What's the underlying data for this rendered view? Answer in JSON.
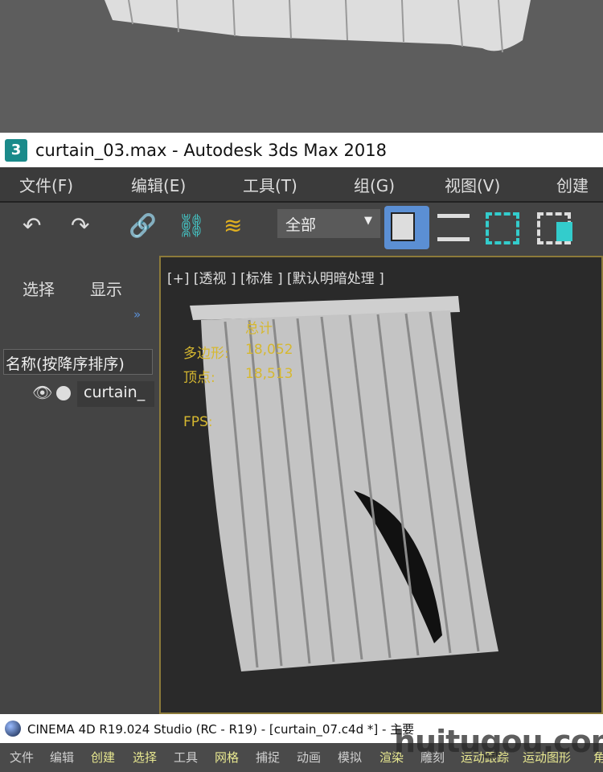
{
  "max_window": {
    "title": "curtain_03.max - Autodesk 3ds Max 2018",
    "logo": "3",
    "menu": [
      "文件(F)",
      "编辑(E)",
      "工具(T)",
      "组(G)",
      "视图(V)",
      "创建"
    ],
    "toolbar": {
      "selection_filter": "全部",
      "icons": [
        "undo-icon",
        "redo-icon",
        "link-icon",
        "unlink-icon",
        "bind-space-warp-icon",
        "select-object-icon",
        "select-by-name-icon",
        "rect-region-icon",
        "window-crossing-icon"
      ]
    },
    "scene_explorer": {
      "tabs": [
        "选择",
        "显示"
      ],
      "expand": "»",
      "column_header": "名称(按降序排序)",
      "items": [
        {
          "name": "curtain_"
        }
      ]
    },
    "viewport": {
      "label": "[+] [透视 ] [标准 ] [默认明暗处理 ]",
      "stats": {
        "heading": "总计",
        "polys_label": "多边形:",
        "polys": "18,052",
        "verts_label": "顶点:",
        "verts": "18,513",
        "fps_label": "FPS:"
      }
    }
  },
  "c4d_window": {
    "title": "CINEMA 4D R19.024 Studio (RC - R19) - [curtain_07.c4d *] - 主要",
    "menu": [
      {
        "l": "文件",
        "c": "#cfcfcf"
      },
      {
        "l": "编辑",
        "c": "#cfcfcf"
      },
      {
        "l": "创建",
        "c": "#e8e890"
      },
      {
        "l": "选择",
        "c": "#e8e890"
      },
      {
        "l": "工具",
        "c": "#cfcfcf"
      },
      {
        "l": "网格",
        "c": "#e8e890"
      },
      {
        "l": "捕捉",
        "c": "#cfcfcf"
      },
      {
        "l": "动画",
        "c": "#cfcfcf"
      },
      {
        "l": "模拟",
        "c": "#cfcfcf"
      },
      {
        "l": "渲染",
        "c": "#e8e890"
      },
      {
        "l": "雕刻",
        "c": "#cfcfcf"
      },
      {
        "l": "运动跟踪",
        "c": "#e8e890"
      },
      {
        "l": "运动图形",
        "c": "#e8e890"
      },
      {
        "l": "角",
        "c": "#e8e890"
      }
    ]
  },
  "watermark": "huitugou.com",
  "colors": {
    "highlight": "#5b8fd4",
    "stats": "#d6b830",
    "viewport_border": "#8c7a3a"
  }
}
